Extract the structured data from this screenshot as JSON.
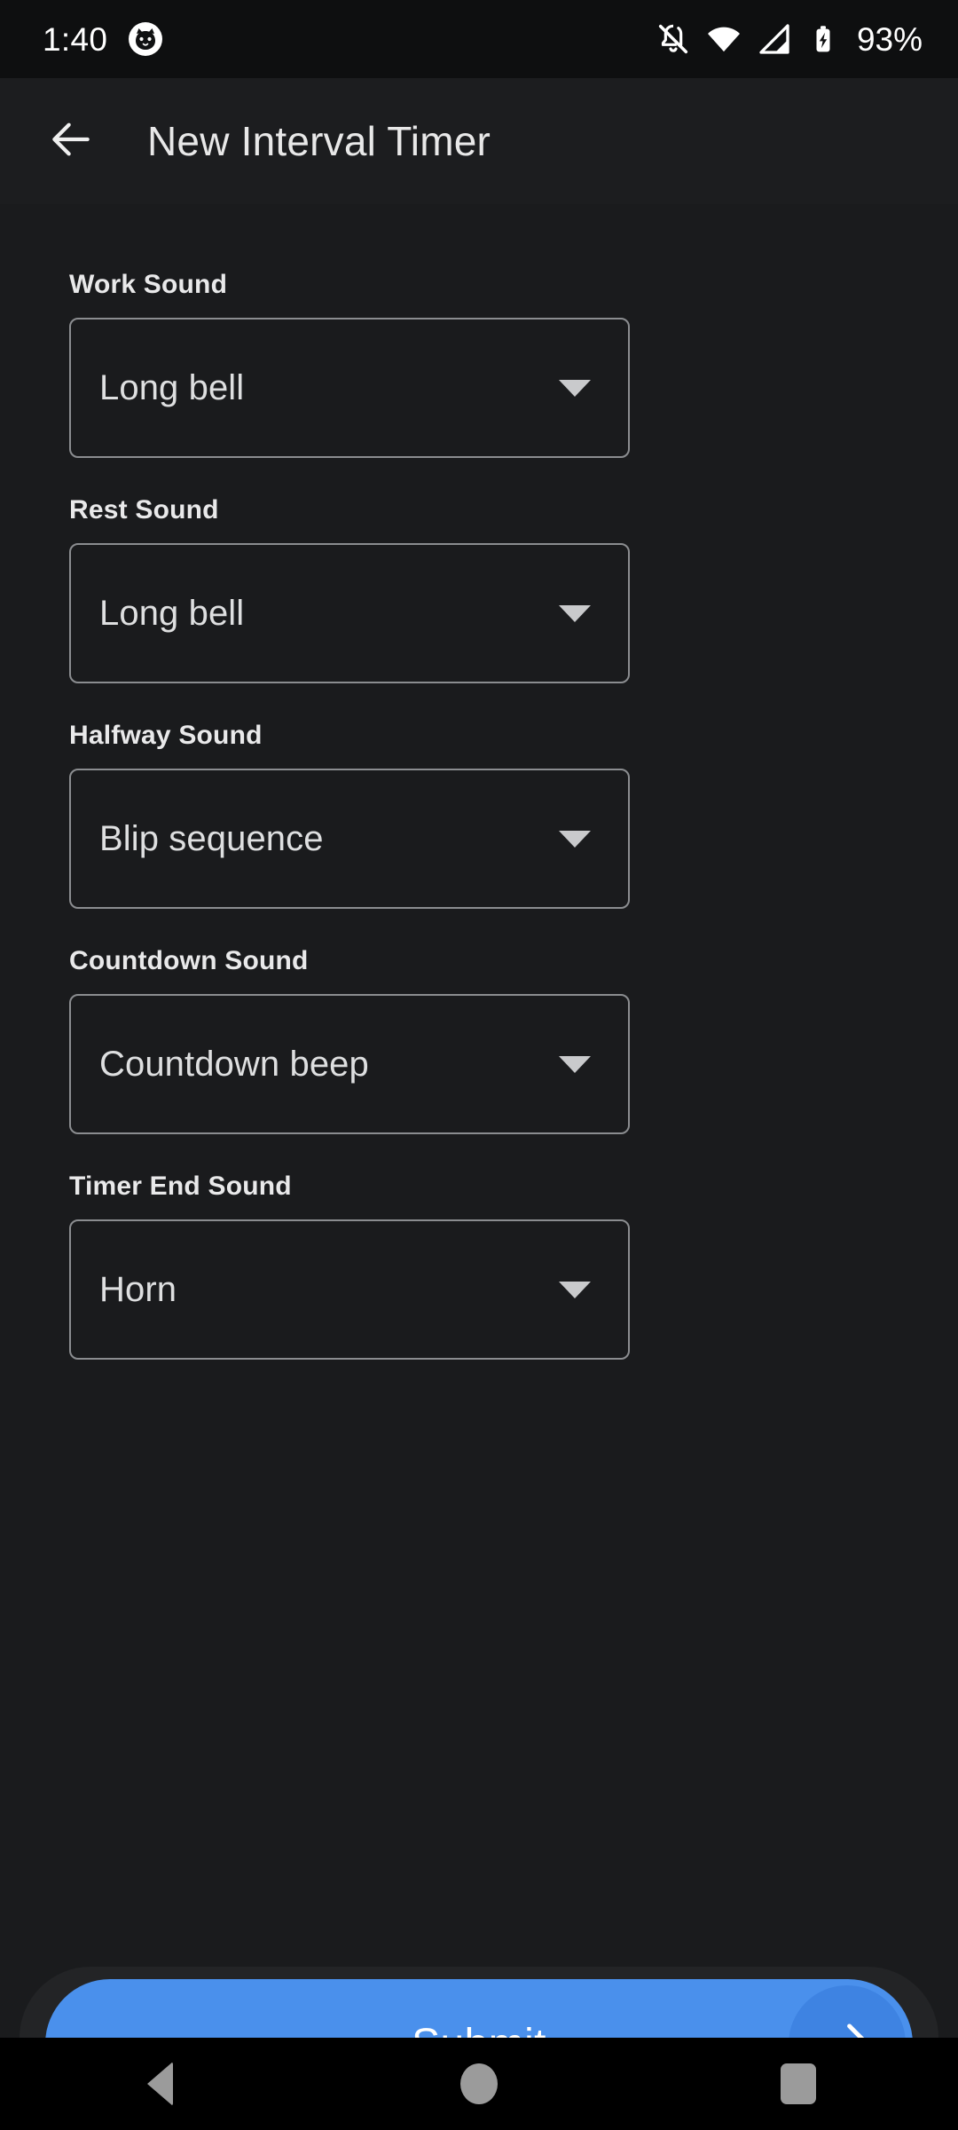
{
  "status_bar": {
    "time": "1:40",
    "notification_icon": "cat-face-icon",
    "icons": [
      "ringer-silent-icon",
      "wifi-icon",
      "cellular-signal-icon",
      "battery-charging-icon"
    ],
    "battery_percent": "93%"
  },
  "app_bar": {
    "back_icon": "arrow-left-icon",
    "title": "New Interval Timer"
  },
  "form": {
    "fields": [
      {
        "label": "Work Sound",
        "value": "Long bell",
        "caret": "caret-down-icon"
      },
      {
        "label": "Rest Sound",
        "value": "Long bell",
        "caret": "caret-down-icon"
      },
      {
        "label": "Halfway Sound",
        "value": "Blip sequence",
        "caret": "caret-down-icon"
      },
      {
        "label": "Countdown Sound",
        "value": "Countdown beep",
        "caret": "caret-down-icon"
      },
      {
        "label": "Timer End Sound",
        "value": "Horn",
        "caret": "caret-down-icon"
      }
    ]
  },
  "submit": {
    "label": "Submit",
    "arrow_icon": "arrow-right-icon",
    "accent_color": "#4a90ec",
    "knob_color": "#3e83e2"
  },
  "nav_bar": {
    "back_icon": "nav-back-triangle-icon",
    "home_icon": "nav-home-circle-icon",
    "recents_icon": "nav-recents-square-icon"
  },
  "colors": {
    "background": "#1a1b1d",
    "app_bar": "#1c1d1f",
    "status_bar": "#0e0f10",
    "field_border": "#8b8d90",
    "text_primary": "#e9e9ea"
  }
}
